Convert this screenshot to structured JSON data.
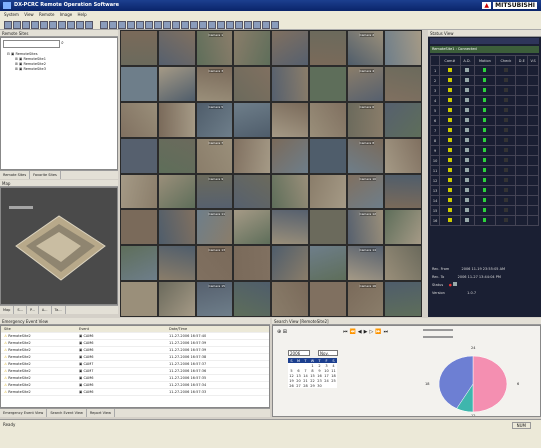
{
  "window": {
    "title": "DX-PCRC Remote Operation Software",
    "logo": "MITSUBISHI"
  },
  "menu": [
    "System",
    "View",
    "Remote",
    "Image",
    "Help"
  ],
  "remote_sites": {
    "title": "Remote Sites",
    "tree": [
      "RemoteSites",
      "RemoteSite1",
      "RemoteSite2",
      "RemoteSite3"
    ],
    "tabs": [
      "Remote Sites",
      "Favorite Sites"
    ]
  },
  "map": {
    "title": "Map",
    "tabs": [
      "Map",
      "S...",
      "P...",
      "A...",
      "Ta..."
    ]
  },
  "camera_grid": {
    "labels": [
      "Camera 1",
      "Camera 2",
      "Camera 3",
      "Camera 4",
      "Camera 5",
      "Camera 6",
      "Camera 7",
      "Camera 8",
      "Camera 9",
      "Camera 10",
      "Camera 11",
      "Camera 12",
      "Camera 13",
      "Camera 14",
      "Camera 15",
      "Camera 16"
    ]
  },
  "status_view": {
    "title": "Status View",
    "site_header": "RemoteSite1 : Connected",
    "columns": [
      "",
      "Cam#",
      "A.D.",
      "Motion",
      "Check",
      "D.E",
      "V.S"
    ],
    "rows": [
      "1",
      "2",
      "3",
      "4",
      "5",
      "6",
      "7",
      "8",
      "9",
      "10",
      "11",
      "12",
      "13",
      "14",
      "15",
      "16"
    ],
    "rec_from_label": "Rec. From",
    "rec_from": "2006 11-19 23:55:05 AM",
    "rec_to_label": "Rec. To",
    "rec_to": "2006 11-27 13:44:04 PM",
    "status_label": "Status",
    "version_label": "Version",
    "version": "1.0.7"
  },
  "event_view": {
    "title": "Emergency Event View",
    "columns": [
      "Site",
      "Event",
      "Date/Time"
    ],
    "rows": [
      [
        "RemoteSite2",
        "CAM6",
        "11-27-2006 16:57:40"
      ],
      [
        "RemoteSite2",
        "CAM6",
        "11-27-2006 16:57:39"
      ],
      [
        "RemoteSite2",
        "CAM6",
        "11-27-2006 16:57:39"
      ],
      [
        "RemoteSite2",
        "CAM6",
        "11-27-2006 16:57:38"
      ],
      [
        "RemoteSite2",
        "CAM7",
        "11-27-2006 16:57:37"
      ],
      [
        "RemoteSite2",
        "CAM7",
        "11-27-2006 16:57:36"
      ],
      [
        "RemoteSite2",
        "CAM6",
        "11-27-2006 16:57:35"
      ],
      [
        "RemoteSite2",
        "CAM6",
        "11-27-2006 16:57:34"
      ],
      [
        "RemoteSite2",
        "CAM6",
        "11-27-2006 16:57:33"
      ]
    ],
    "tabs": [
      "Emergency Event View",
      "Search Event View",
      "Report View"
    ]
  },
  "search_view": {
    "title": "Search View [RemoteSite2]",
    "year": "2006",
    "month": "Nov.",
    "weekdays": [
      "S",
      "M",
      "T",
      "W",
      "T",
      "F",
      "S"
    ],
    "calendar_rows": [
      [
        "",
        "",
        "",
        "1",
        "2",
        "3",
        "4"
      ],
      [
        "5",
        "6",
        "7",
        "8",
        "9",
        "10",
        "11"
      ],
      [
        "12",
        "13",
        "14",
        "15",
        "16",
        "17",
        "18"
      ],
      [
        "19",
        "20",
        "21",
        "22",
        "23",
        "24",
        "25"
      ],
      [
        "26",
        "27",
        "28",
        "29",
        "30",
        "",
        ""
      ]
    ],
    "clock_labels": [
      "24",
      "6",
      "12",
      "18"
    ],
    "pie": {
      "segments": [
        {
          "label": "pink",
          "fraction": 0.5,
          "color": "#f48fb1"
        },
        {
          "label": "teal",
          "fraction": 0.08,
          "color": "#3fb6ad"
        },
        {
          "label": "blue",
          "fraction": 0.42,
          "color": "#6d7fd3"
        }
      ]
    }
  },
  "statusbar": {
    "left": "Ready",
    "right": "NUM"
  }
}
